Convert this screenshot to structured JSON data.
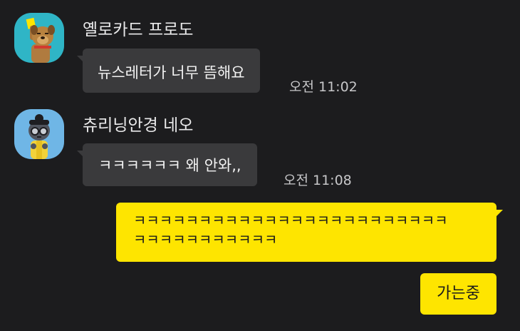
{
  "colors": {
    "background": "#1c1c1e",
    "incoming_bubble": "#3a3a3c",
    "outgoing_bubble": "#fee500",
    "avatar1_bg": "#2fb5c6",
    "avatar2_bg": "#6fb6e6"
  },
  "messages": [
    {
      "sender": "옐로카드 프로도",
      "avatar_icon": "frodo-dog-yellow-card-icon",
      "text": "뉴스레터가 너무 뜸해요",
      "time": "오전 11:02"
    },
    {
      "sender": "츄리닝안경 네오",
      "avatar_icon": "neo-cat-glasses-icon",
      "text": "ㅋㅋㅋㅋㅋㅋ 왜 안와,,",
      "time": "오전 11:08"
    }
  ],
  "my_messages": [
    {
      "line1": "ㅋㅋㅋㅋㅋㅋㅋㅋㅋㅋㅋㅋㅋㅋㅋㅋㅋㅋㅋㅋㅋㅋㅋㅋ",
      "line2": "ㅋㅋㅋㅋㅋㅋㅋㅋㅋㅋㅋ"
    },
    {
      "text": "가는중"
    }
  ]
}
